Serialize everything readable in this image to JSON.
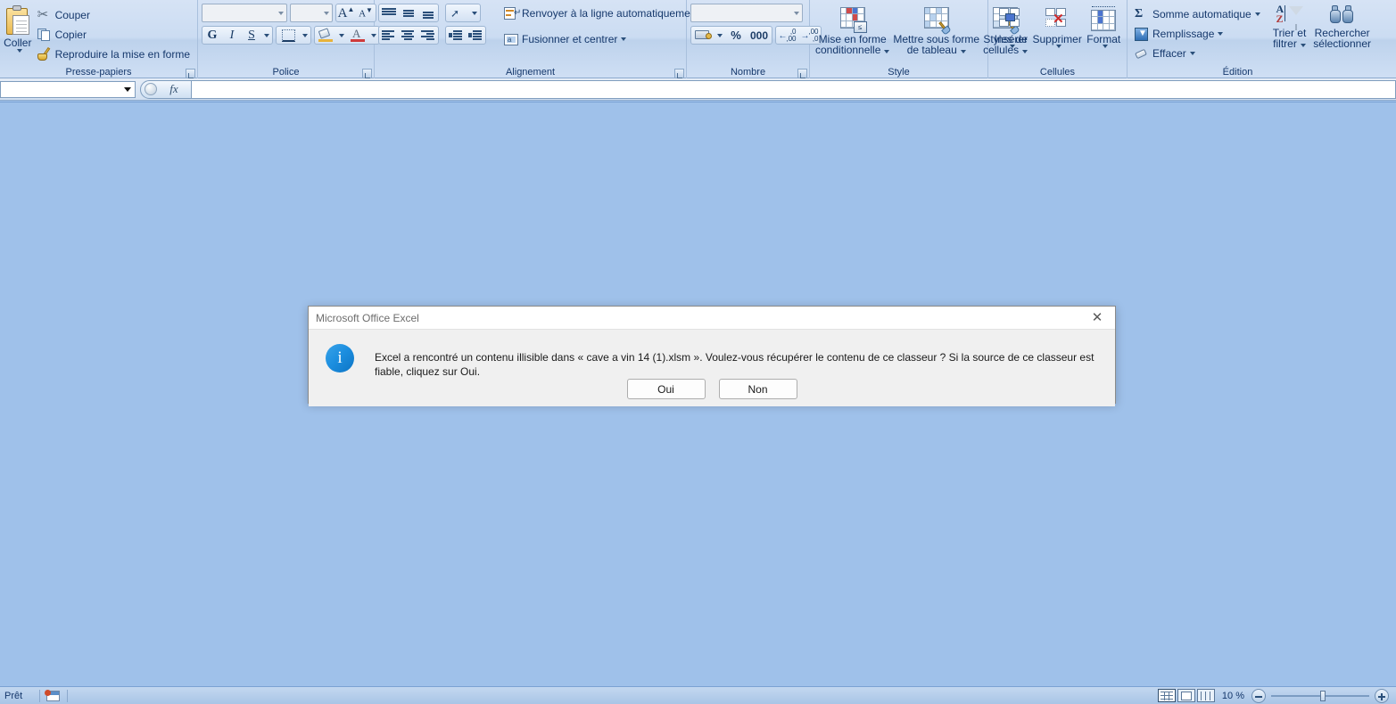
{
  "app": {
    "name": "Microsoft Office Excel"
  },
  "ribbon": {
    "groups": {
      "clipboard": {
        "label": "Presse-papiers",
        "paste": "Coller",
        "cut": "Couper",
        "copy": "Copier",
        "format_painter": "Reproduire la mise en forme"
      },
      "font": {
        "label": "Police",
        "font_name_value": "",
        "font_size_value": "",
        "bold": "G",
        "italic": "I",
        "underline": "S"
      },
      "alignment": {
        "label": "Alignement",
        "wrap_text": "Renvoyer à la ligne automatiquement",
        "merge_center": "Fusionner et centrer"
      },
      "number": {
        "label": "Nombre",
        "format_value": "",
        "percent": "%",
        "thousands": "000"
      },
      "style": {
        "label": "Style",
        "conditional_line1": "Mise en forme",
        "conditional_line2": "conditionnelle",
        "table_line1": "Mettre sous forme",
        "table_line2": "de tableau",
        "cellstyles_line1": "Styles de",
        "cellstyles_line2": "cellules"
      },
      "cells": {
        "label": "Cellules",
        "insert": "Insérer",
        "delete": "Supprimer",
        "format": "Format"
      },
      "editing": {
        "label": "Édition",
        "autosum": "Somme automatique",
        "fill": "Remplissage",
        "clear": "Effacer",
        "sort_filter_line1": "Trier et",
        "sort_filter_line2": "filtrer",
        "find_select_line1": "Rechercher",
        "find_select_line2": "sélectionner"
      }
    }
  },
  "formula_bar": {
    "name_box_value": "",
    "fx_label": "fx",
    "formula_value": ""
  },
  "status_bar": {
    "ready": "Prêt",
    "zoom_level": "10 %"
  },
  "dialog": {
    "title": "Microsoft Office Excel",
    "message": "Excel a rencontré un contenu illisible dans « cave a vin 14 (1).xlsm ». Voulez-vous récupérer le contenu de ce classeur ? Si la source de ce classeur est fiable, cliquez sur Oui.",
    "button_yes": "Oui",
    "button_no": "Non",
    "close_glyph": "✕"
  },
  "colors": {
    "workspace": "#9fc1ea",
    "ribbon_top": "#d6e3f5",
    "accent_blue": "#1d8fe0",
    "group_label": "#3f6889"
  }
}
